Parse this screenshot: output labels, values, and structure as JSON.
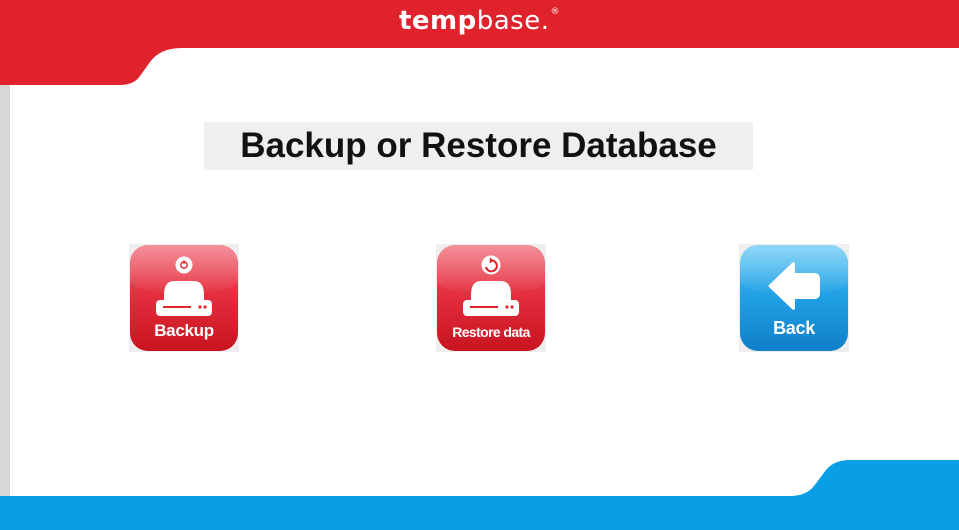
{
  "header": {
    "brand_bold": "temp",
    "brand_light": "base.",
    "brand_mark": "®",
    "color": "#e0222c"
  },
  "page": {
    "title": "Backup or Restore Database"
  },
  "actions": [
    {
      "label": "Backup",
      "icon": "drive-backup-icon",
      "color": "#e0222c"
    },
    {
      "label": "Restore data",
      "icon": "drive-restore-icon",
      "color": "#e0222c"
    },
    {
      "label": "Back",
      "icon": "arrow-left-icon",
      "color": "#1e9fe3"
    }
  ],
  "footer": {
    "color": "#0a9ee6"
  }
}
